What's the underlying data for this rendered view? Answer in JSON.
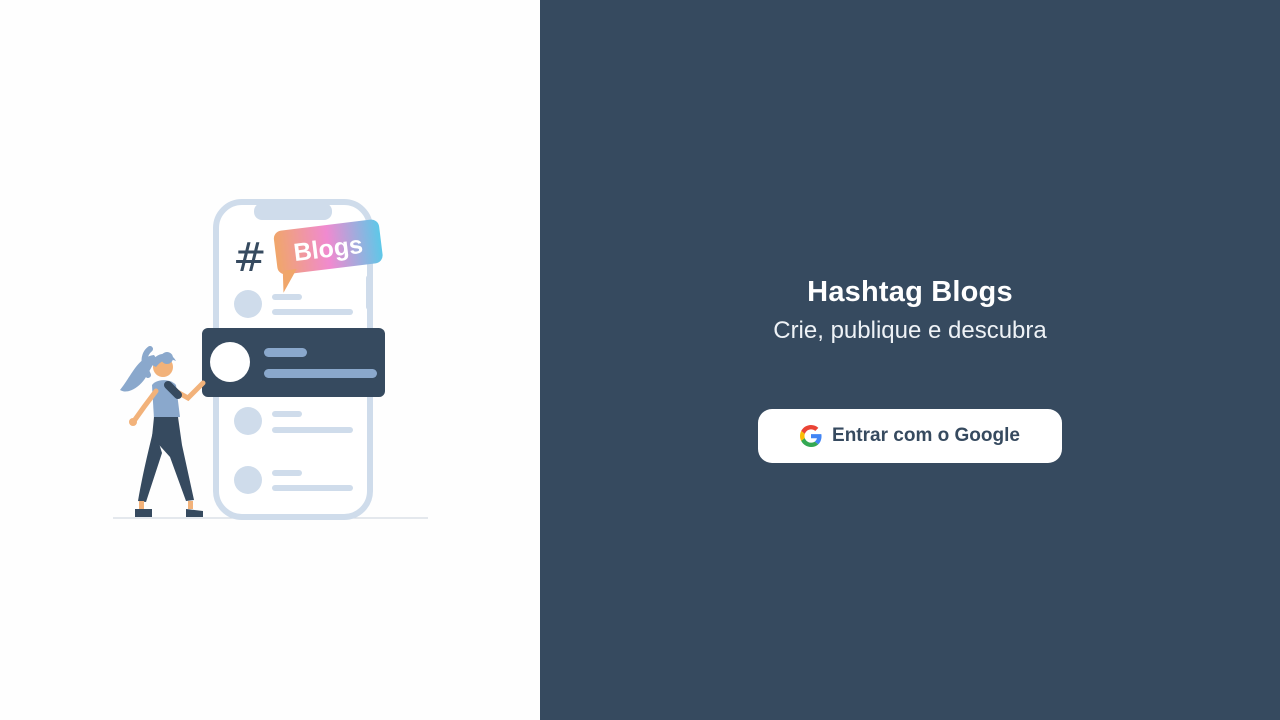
{
  "app": {
    "title": "Hashtag Blogs",
    "subtitle": "Crie, publique e descubra"
  },
  "login": {
    "google_button_label": "Entrar com o Google",
    "google_icon": "google-g-icon"
  },
  "illustration": {
    "hashtag": "#",
    "badge_text": "Blogs"
  },
  "colors": {
    "panel_bg": "#364a5f",
    "left_bg": "#fefefe",
    "phone_outline": "#cfdceb",
    "card_dark": "#364a5f",
    "accent_light": "#8aa8cc"
  }
}
